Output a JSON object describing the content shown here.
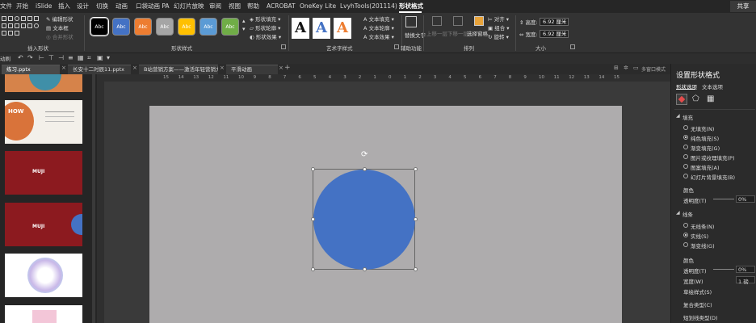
{
  "menubar": {
    "tabs": [
      "文件",
      "开始",
      "iSlide",
      "插入",
      "设计",
      "切换",
      "动画",
      "口袋动画 PA",
      "幻灯片放映",
      "审阅",
      "视图",
      "帮助",
      "ACROBAT",
      "OneKey Lite",
      "LvyhTools(201114)",
      "形状格式"
    ],
    "active_tab": "形状格式",
    "share_label": "共享"
  },
  "ribbon": {
    "insert_shapes": {
      "label": "插入形状",
      "edit_shape": "编辑形状",
      "text_box": "文本框",
      "merge_shapes": "合并形状"
    },
    "shape_styles": {
      "label": "形状样式",
      "swatch_text": "Abc",
      "swatches": [
        "#000000",
        "#4472c4",
        "#ed7d31",
        "#a5a5a5",
        "#ffc000",
        "#5b9bd5",
        "#70ad47"
      ],
      "fill": "形状填充",
      "outline": "形状轮廓",
      "effects": "形状效果"
    },
    "wordart": {
      "label": "艺术字样式",
      "letter": "A",
      "text_fill": "文本填充",
      "text_outline": "文本轮廓",
      "text_effects": "文本效果"
    },
    "accessibility": {
      "label": "辅助功能",
      "alt_text": "替换文字"
    },
    "arrange": {
      "label": "排列",
      "bring_forward": "上移一层",
      "send_backward": "下移一层",
      "selection_pane": "选择窗格",
      "align": "对齐",
      "group": "组合",
      "rotate": "旋转"
    },
    "size": {
      "label": "大小",
      "height_label": "高度:",
      "height_value": "6.92 厘米",
      "width_label": "宽度:",
      "width_value": "6.92 厘米"
    }
  },
  "quick_access": {
    "left_label": "动刷"
  },
  "doc_tabs": [
    {
      "label": "练习.pptx"
    },
    {
      "label": "长安十二时辰11.pptx"
    },
    {
      "label": "B站营销方案——激活年轻营销力"
    },
    {
      "label": "平滑动画"
    }
  ],
  "tabbar_right": {
    "label": "多窗口模式"
  },
  "slides": {
    "thumb2_title": "HOW",
    "thumb3_title": "MUJI"
  },
  "ruler": {
    "ticks": [
      "15",
      "14",
      "13",
      "12",
      "11",
      "10",
      "9",
      "8",
      "7",
      "6",
      "5",
      "4",
      "3",
      "2",
      "1",
      "0",
      "1",
      "2",
      "3",
      "4",
      "5",
      "6",
      "7",
      "8",
      "9",
      "10",
      "11",
      "12",
      "13",
      "14",
      "15"
    ]
  },
  "canvas": {
    "circle_color": "#4472c4",
    "slide_bg": "#aeacad"
  },
  "format_pane": {
    "title": "设置形状格式",
    "tab_shape": "形状选项",
    "tab_text": "文本选项",
    "fill": {
      "header": "填充",
      "options": [
        "无填充(N)",
        "纯色填充(S)",
        "渐变填充(G)",
        "图片或纹理填充(P)",
        "图案填充(A)",
        "幻灯片背景填充(B)"
      ],
      "selected": 1,
      "color_label": "颜色",
      "transparency_label": "透明度(T)",
      "transparency_value": "0%"
    },
    "line": {
      "header": "线条",
      "options": [
        "无线条(N)",
        "实线(S)",
        "渐变线(G)"
      ],
      "selected": 1,
      "color_label": "颜色",
      "transparency_label": "透明度(T)",
      "transparency_value": "0%",
      "width_label": "宽度(W)",
      "width_value": "1 磅",
      "compound_label": "复合类型(C)",
      "dash_label": "短划线类型(D)",
      "sketch_label": "草绘样式(S)"
    }
  }
}
